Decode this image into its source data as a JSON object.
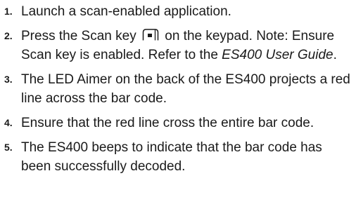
{
  "steps": [
    {
      "number": "1.",
      "text": "Launch a scan-enabled application."
    },
    {
      "number": "2.",
      "text_before_icon": "Press the Scan key",
      "icon": "scan-key-icon",
      "text_after_icon": "on the keypad. Note: Ensure Scan key is enabled. Refer to the",
      "link_text": "ES400 User Guide",
      "text_end": "."
    },
    {
      "number": "3.",
      "text": "The LED Aimer on the back of the ES400 projects a red line across the bar code."
    },
    {
      "number": "4.",
      "text": "Ensure that the red line cross the entire bar code."
    },
    {
      "number": "5.",
      "text": "The ES400 beeps to indicate that the bar code has been successfully decoded."
    }
  ]
}
